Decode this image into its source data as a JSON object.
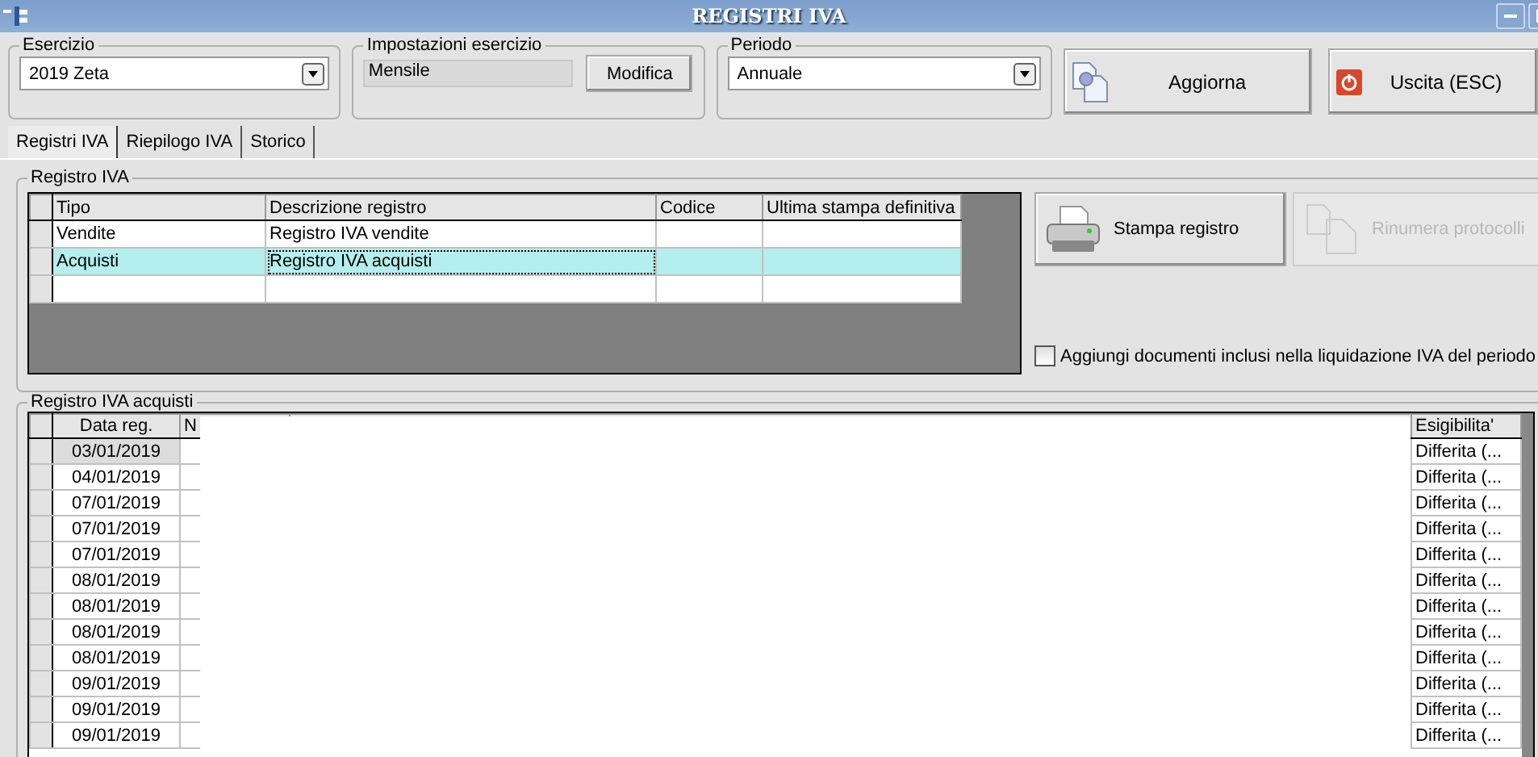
{
  "window": {
    "title": "REGISTRI IVA"
  },
  "esercizio": {
    "label": "Esercizio",
    "value": "2019 Zeta"
  },
  "impostazioni": {
    "label": "Impostazioni esercizio",
    "value": "Mensile",
    "button": "Modifica"
  },
  "periodo": {
    "label": "Periodo",
    "value": "Annuale"
  },
  "toolbar_buttons": [
    {
      "label": "Aggiorna",
      "kind": "refresh"
    },
    {
      "label": "Uscita (ESC)",
      "kind": "exit"
    }
  ],
  "tabs": [
    {
      "label": "Registri IVA",
      "selected": true
    },
    {
      "label": "Riepilogo IVA",
      "selected": false
    },
    {
      "label": "Storico",
      "selected": false
    }
  ],
  "registro": {
    "title": "Registro IVA",
    "columns": [
      "Tipo",
      "Descrizione registro",
      "Codice",
      "Ultima stampa definitiva"
    ],
    "rows": [
      {
        "tipo": "Vendite",
        "descrizione": "Registro IVA vendite",
        "selected": false
      },
      {
        "tipo": "Acquisti",
        "descrizione": "Registro IVA acquisti",
        "selected": true
      }
    ]
  },
  "actions": [
    {
      "label": "Stampa registro",
      "kind": "print",
      "disabled": false
    },
    {
      "label": "Rinumera protocolli",
      "kind": "renumber",
      "disabled": true
    }
  ],
  "include_checkbox": {
    "label": "Aggiungi documenti inclusi nella liquidazione IVA del periodo",
    "checked": false
  },
  "acquisti": {
    "title": "Registro IVA acquisti",
    "columns": [
      "Data reg.",
      "N",
      "Esigibilita'"
    ],
    "rows": [
      {
        "data_reg": "03/01/2019",
        "esigibilita": "Differita (...",
        "selected": true
      },
      {
        "data_reg": "04/01/2019",
        "esigibilita": "Differita (...",
        "selected": false
      },
      {
        "data_reg": "07/01/2019",
        "esigibilita": "Differita (...",
        "selected": false
      },
      {
        "data_reg": "07/01/2019",
        "esigibilita": "Differita (...",
        "selected": false
      },
      {
        "data_reg": "07/01/2019",
        "esigibilita": "Differita (...",
        "selected": false
      },
      {
        "data_reg": "08/01/2019",
        "esigibilita": "Differita (...",
        "selected": false
      },
      {
        "data_reg": "08/01/2019",
        "esigibilita": "Differita (...",
        "selected": false
      },
      {
        "data_reg": "08/01/2019",
        "esigibilita": "Differita (...",
        "selected": false
      },
      {
        "data_reg": "08/01/2019",
        "esigibilita": "Differita (...",
        "selected": false
      },
      {
        "data_reg": "09/01/2019",
        "esigibilita": "Differita (...",
        "selected": false
      },
      {
        "data_reg": "09/01/2019",
        "esigibilita": "Differita (...",
        "selected": false
      },
      {
        "data_reg": "09/01/2019",
        "esigibilita": "Differita (...",
        "selected": false
      }
    ]
  }
}
